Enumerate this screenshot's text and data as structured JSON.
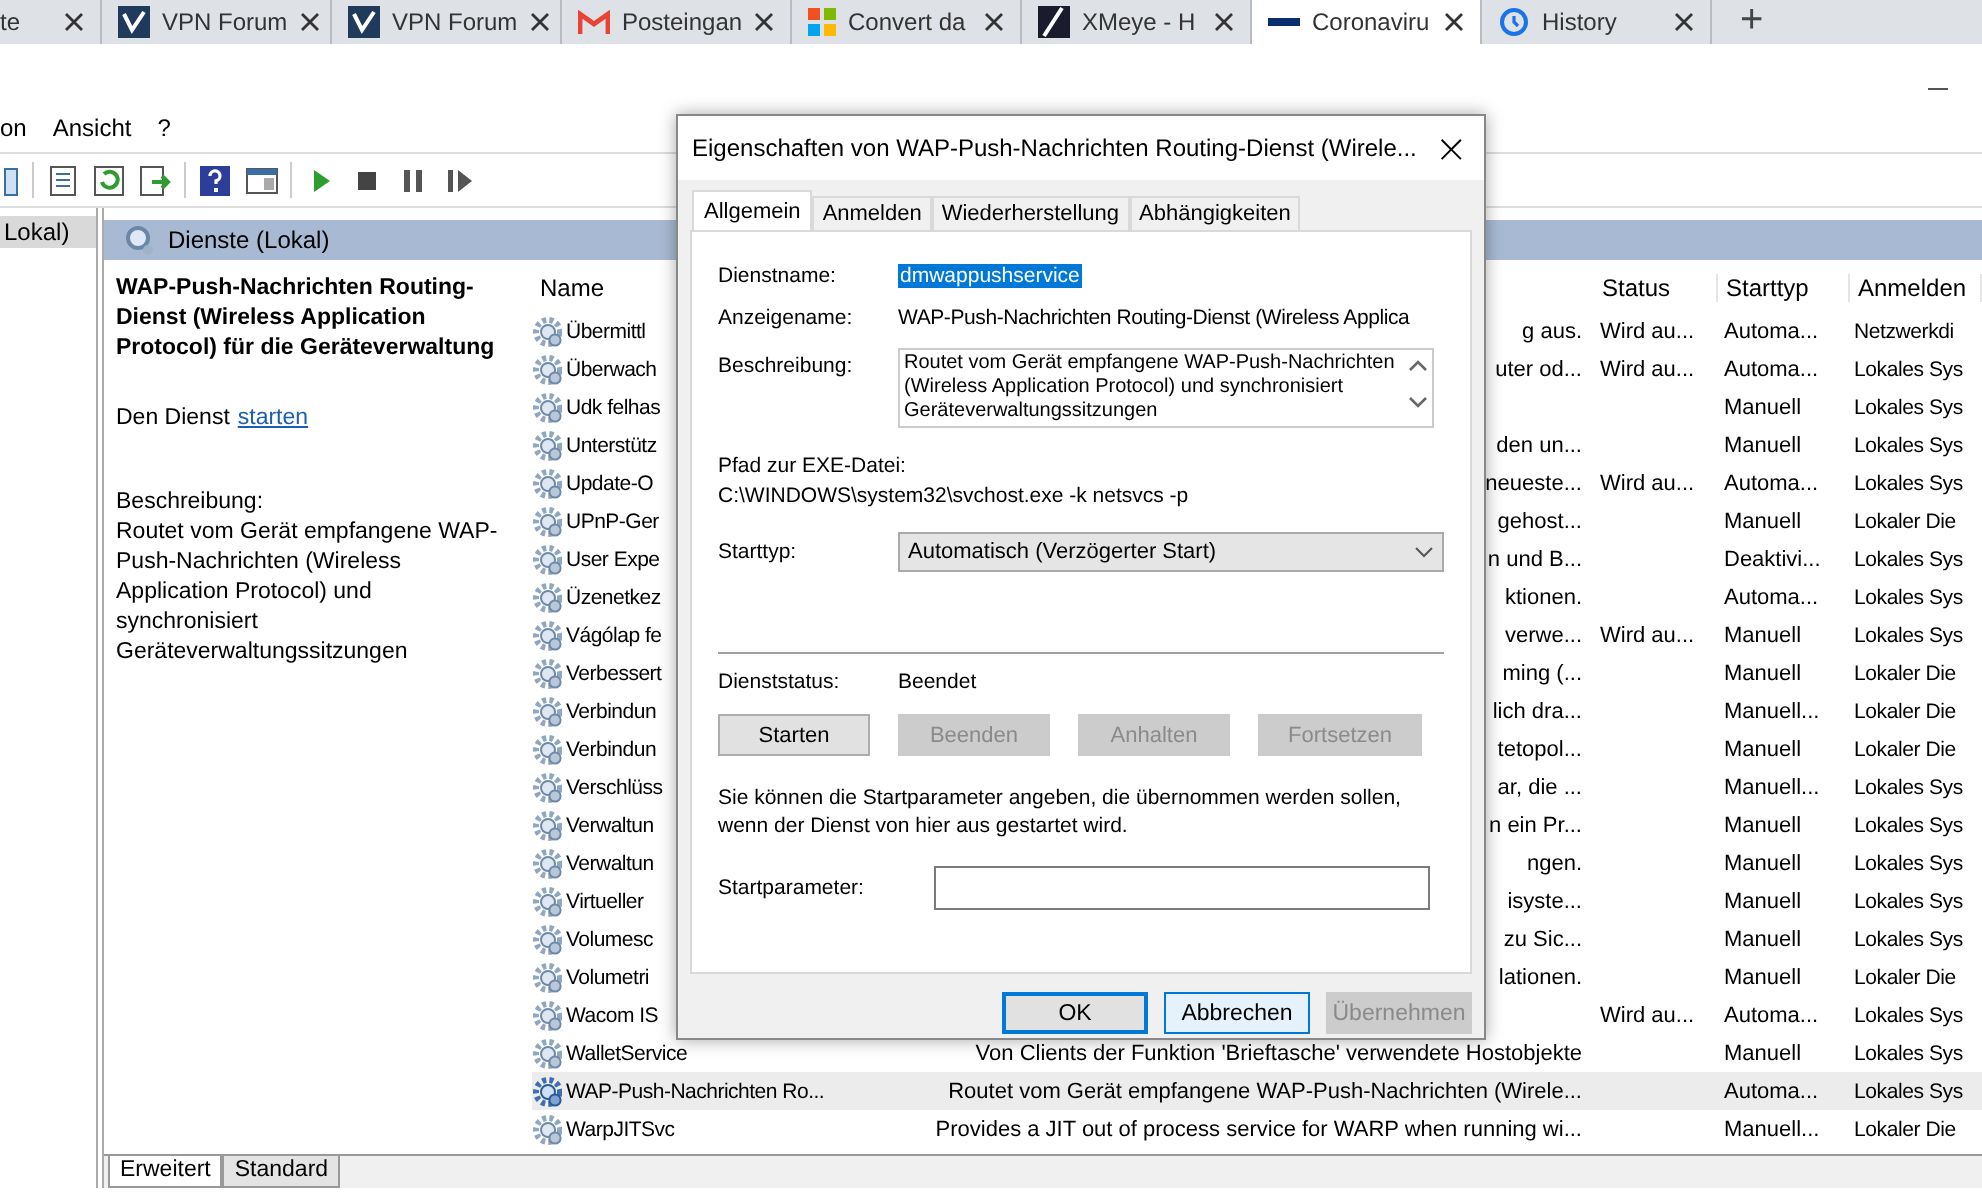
{
  "browser_tabs": [
    {
      "label": "te",
      "kind": "plain",
      "selected": false
    },
    {
      "label": "VPN Forum",
      "kind": "shield",
      "selected": false
    },
    {
      "label": "VPN Forum",
      "kind": "shield",
      "selected": false
    },
    {
      "label": "Posteingan",
      "kind": "mail",
      "selected": false
    },
    {
      "label": "Convert da",
      "kind": "tiles",
      "selected": false
    },
    {
      "label": "XMeye - H",
      "kind": "slash",
      "selected": false
    },
    {
      "label": "Coronaviru",
      "kind": "bar",
      "selected": true
    },
    {
      "label": "History",
      "kind": "clock",
      "selected": false
    }
  ],
  "new_tab": "+",
  "menu": [
    "on",
    "Ansicht",
    "?"
  ],
  "tree": {
    "items": [
      {
        "label": "Lokal)",
        "selected": true
      }
    ]
  },
  "panel_header": "Dienste (Lokal)",
  "details": {
    "title": "WAP-Push-Nachrichten Routing-Dienst (Wireless Application Protocol) für die Geräteverwaltung",
    "action_prefix": "Den Dienst",
    "action_link": "starten",
    "description_label": "Beschreibung:",
    "description": "Routet vom Gerät empfangene WAP-Push-Nachrichten (Wireless Application Protocol) und synchronisiert Geräteverwaltungssitzungen"
  },
  "table": {
    "columns": [
      "Name",
      "",
      "Status",
      "Starttyp",
      "Anmelden"
    ],
    "rows": [
      {
        "name": "Übermittl",
        "description": "g aus.",
        "status": "Wird au...",
        "startup": "Automa...",
        "logon": "Netzwerkdi",
        "selected": false
      },
      {
        "name": "Überwach",
        "description": "uter od...",
        "status": "Wird au...",
        "startup": "Automa...",
        "logon": "Lokales Sys",
        "selected": false
      },
      {
        "name": "Udk felhas",
        "startup": "Manuell",
        "logon": "Lokales Sys",
        "selected": false
      },
      {
        "name": "Unterstütz",
        "description": "den un...",
        "startup": "Manuell",
        "logon": "Lokales Sys",
        "selected": false
      },
      {
        "name": "Update-O",
        "description": "neueste...",
        "status": "Wird au...",
        "startup": "Automa...",
        "logon": "Lokales Sys",
        "selected": false
      },
      {
        "name": "UPnP-Ger",
        "description": "gehost...",
        "startup": "Manuell",
        "logon": "Lokaler Die",
        "selected": false
      },
      {
        "name": "User Expe",
        "description": "n und B...",
        "startup": "Deaktivi...",
        "logon": "Lokales Sys",
        "selected": false
      },
      {
        "name": "Üzenetkez",
        "description": "ktionen.",
        "startup": "Automa...",
        "logon": "Lokales Sys",
        "selected": false
      },
      {
        "name": "Vágólap fe",
        "description": "verwe...",
        "status": "Wird au...",
        "startup": "Manuell",
        "logon": "Lokales Sys",
        "selected": false
      },
      {
        "name": "Verbessert",
        "description": "ming (...",
        "startup": "Manuell",
        "logon": "Lokaler Die",
        "selected": false
      },
      {
        "name": "Verbindun",
        "description": "lich dra...",
        "startup": "Manuell...",
        "logon": "Lokaler Die",
        "selected": false
      },
      {
        "name": "Verbindun",
        "description": "tetopol...",
        "startup": "Manuell",
        "logon": "Lokaler Die",
        "selected": false
      },
      {
        "name": "Verschlüss",
        "description": "ar, die ...",
        "startup": "Manuell...",
        "logon": "Lokales Sys",
        "selected": false
      },
      {
        "name": "Verwaltun",
        "description": "n ein Pr...",
        "startup": "Manuell",
        "logon": "Lokales Sys",
        "selected": false
      },
      {
        "name": "Verwaltun",
        "description": "ngen.",
        "startup": "Manuell",
        "logon": "Lokales Sys",
        "selected": false
      },
      {
        "name": "Virtueller",
        "description": "isyste...",
        "startup": "Manuell",
        "logon": "Lokales Sys",
        "selected": false
      },
      {
        "name": "Volumesc",
        "description": "zu Sic...",
        "startup": "Manuell",
        "logon": "Lokales Sys",
        "selected": false
      },
      {
        "name": "Volumetri",
        "description": "lationen.",
        "startup": "Manuell",
        "logon": "Lokaler Die",
        "selected": false
      },
      {
        "name": "Wacom IS",
        "status": "Wird au...",
        "startup": "Automa...",
        "logon": "Lokales Sys",
        "selected": false
      },
      {
        "name": "WalletService",
        "description": "Von Clients der Funktion 'Brieftasche' verwendete Hostobjekte",
        "startup": "Manuell",
        "logon": "Lokales Sys",
        "selected": false
      },
      {
        "name": "WAP-Push-Nachrichten Ro...",
        "description": "Routet vom Gerät empfangene WAP-Push-Nachrichten (Wirele...",
        "startup": "Automa...",
        "logon": "Lokales Sys",
        "selected": true
      },
      {
        "name": "WarpJITSvc",
        "description": "Provides a JIT out of process service for WARP when running wi...",
        "startup": "Manuell...",
        "logon": "Lokaler Die",
        "selected": false
      }
    ]
  },
  "view_tabs": [
    {
      "label": "Erweitert",
      "selected": true
    },
    {
      "label": "Standard",
      "selected": false
    }
  ],
  "dialog": {
    "title": "Eigenschaften von WAP-Push-Nachrichten Routing-Dienst (Wirele...",
    "close": "×",
    "tabs": [
      {
        "label": "Allgemein",
        "selected": true
      },
      {
        "label": "Anmelden",
        "selected": false
      },
      {
        "label": "Wiederherstellung",
        "selected": false
      },
      {
        "label": "Abhängigkeiten",
        "selected": false
      }
    ],
    "service_name_label": "Dienstname:",
    "service_name": "dmwappushservice",
    "display_name_label": "Anzeigename:",
    "display_name": "WAP-Push-Nachrichten Routing-Dienst (Wireless Applica",
    "description_label": "Beschreibung:",
    "description": "Routet vom Gerät empfangene WAP-Push-Nachrichten (Wireless Application Protocol) und synchronisiert Geräteverwaltungssitzungen",
    "path_label": "Pfad zur EXE-Datei:",
    "path": "C:\\WINDOWS\\system32\\svchost.exe -k netsvcs -p",
    "startup_label": "Starttyp:",
    "startup": "Automatisch (Verzögerter Start)",
    "status_label": "Dienststatus:",
    "status": "Beendet",
    "service_buttons": [
      {
        "label": "Starten",
        "disabled": false
      },
      {
        "label": "Beenden",
        "disabled": true
      },
      {
        "label": "Anhalten",
        "disabled": true
      },
      {
        "label": "Fortsetzen",
        "disabled": true
      }
    ],
    "hint": "Sie können die Startparameter angeben, die übernommen werden sollen, wenn der Dienst von hier aus gestartet wird.",
    "params_label": "Startparameter:",
    "buttons": [
      {
        "label": "OK",
        "default": true,
        "hovered": false,
        "disabled": false
      },
      {
        "label": "Abbrechen",
        "default": false,
        "hovered": true,
        "disabled": false
      },
      {
        "label": "Übernehmen",
        "default": false,
        "hovered": false,
        "disabled": true
      }
    ]
  }
}
